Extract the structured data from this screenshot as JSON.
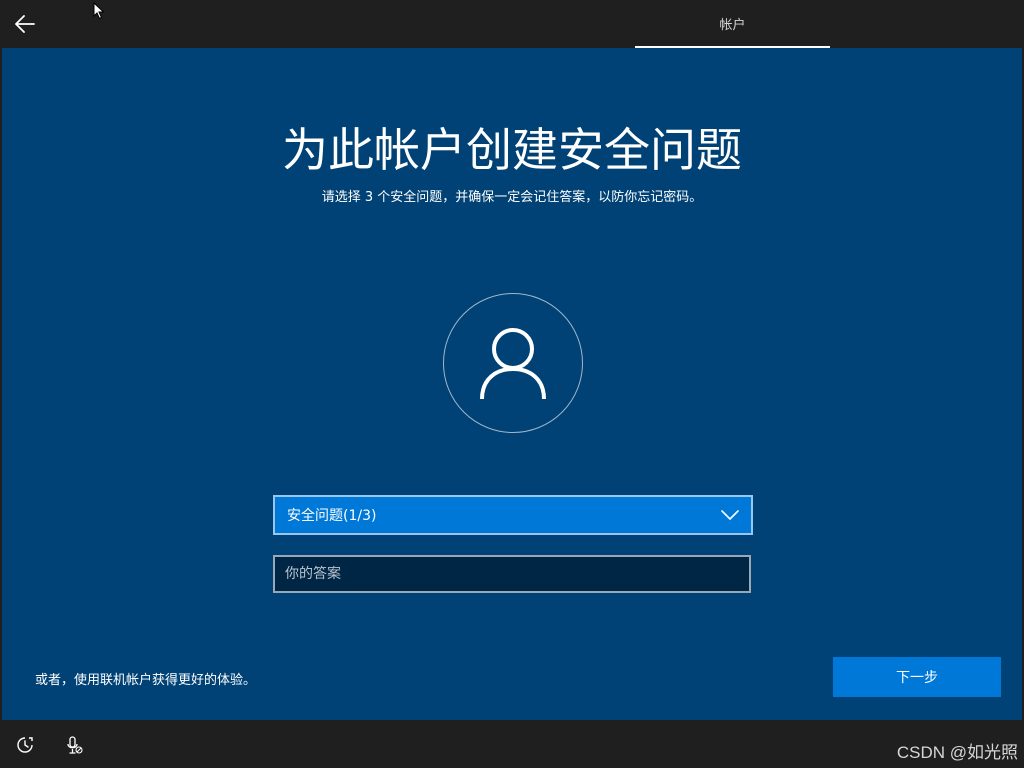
{
  "header": {
    "tab_label": "帐户"
  },
  "main": {
    "title": "为此帐户创建安全问题",
    "subtitle": "请选择 3 个安全问题，并确保一定会记住答案，以防你忘记密码。",
    "security_question": {
      "selected_label": "安全问题(1/3)"
    },
    "answer": {
      "value": "",
      "placeholder": "你的答案"
    },
    "alt_link": "或者，使用联机帐户获得更好的体验。",
    "next_label": "下一步"
  },
  "footer": {
    "watermark": "CSDN @如光照"
  },
  "icons": {
    "back": "back-arrow-icon",
    "avatar": "user-icon",
    "chevron": "chevron-down-icon",
    "ease_of_access": "ease-of-access-icon",
    "microphone": "microphone-muted-icon"
  },
  "colors": {
    "panel": "#004275",
    "accent": "#0078d7",
    "bar": "#1f1f1f"
  }
}
